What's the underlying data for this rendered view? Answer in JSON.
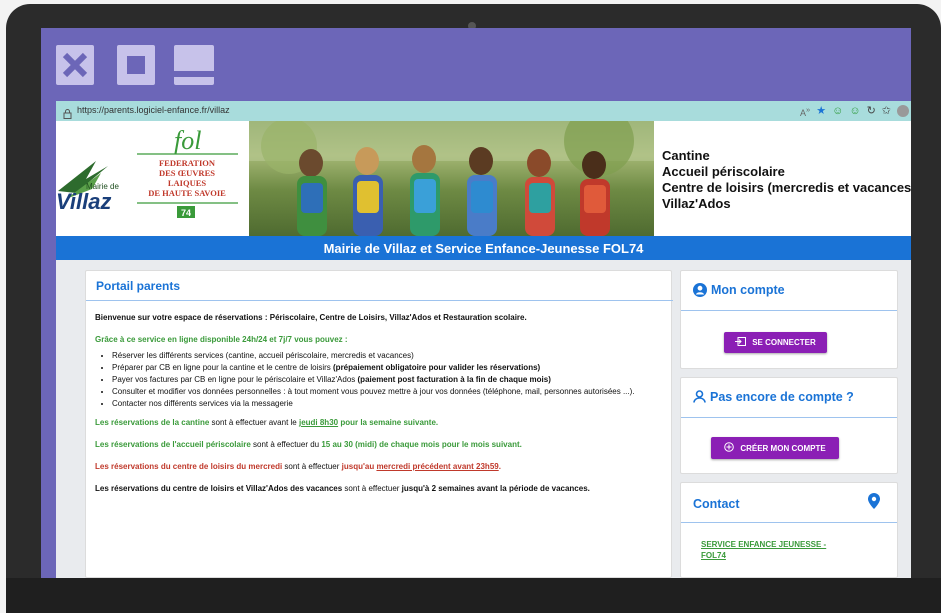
{
  "window_controls": {
    "close": "close-icon",
    "maximize": "maximize-icon",
    "minimize": "minimize-icon"
  },
  "address_bar": {
    "url": "https://parents.logiciel-enfance.fr/villaz"
  },
  "header": {
    "mairie_logo_prefix": "Mairie de",
    "mairie_logo_name": "Villaz",
    "fol_logo_lines": [
      "FEDERATION",
      "DES ŒUVRES",
      "LAIQUES",
      "DE HAUTE SAVOIE"
    ],
    "fol_logo_number": "74",
    "services": [
      "Cantine",
      "Accueil périscolaire",
      "Centre de loisirs (mercredis et vacances)",
      "Villaz'Ados"
    ]
  },
  "title_bar": "Mairie de Villaz et Service Enfance-Jeunesse FOL74",
  "portal": {
    "title": "Portail parents",
    "welcome": "Bienvenue sur votre espace de réservations : Périscolaire, Centre de Loisirs, Villaz'Ados et Restauration scolaire.",
    "intro": "Grâce à ce service en ligne disponible 24h/24 et 7j/7 vous pouvez :",
    "bullets": {
      "b1": "Réserver les différents services (cantine, accueil périscolaire, mercredis et vacances)",
      "b2_a": "Préparer par CB en ligne pour la cantine et le centre de loisirs ",
      "b2_b": "(prépaiement obligatoire pour valider les réservations)",
      "b3_a": "Payer vos factures par CB en ligne pour le périscolaire et Villaz'Ados ",
      "b3_b": "(paiement post facturation à la fin de chaque mois)",
      "b4": "Consulter et modifier vos données personnelles : à tout moment vous pouvez mettre à jour vos données (téléphone, mail, personnes autorisées ...).",
      "b5": "Contacter nos différents services via la messagerie"
    },
    "cantine": {
      "a": "Les réservations de la cantine",
      "b": " sont à effectuer avant le ",
      "c": "jeudi 8h30",
      "d": " pour la semaine suivante."
    },
    "periscolaire": {
      "a": "Les réservations de l'accueil périscolaire",
      "b": " sont à effectuer du ",
      "c": "15 au 30 (midi) de chaque mois pour le mois suivant."
    },
    "mercredi": {
      "a": "Les réservations du centre de loisirs du mercredi",
      "b": " sont à effectuer ",
      "c": "jusqu'au ",
      "d": "mercredi précédent avant 23h59",
      "e": "."
    },
    "vacances": {
      "a": "Les réservations du centre de loisirs et Villaz'Ados des vacances",
      "b": " sont à effectuer ",
      "c": "jusqu'à 2 semaines avant la période de vacances."
    }
  },
  "account": {
    "title": "Mon compte",
    "login_button": "SE CONNECTER"
  },
  "signup": {
    "title": "Pas encore de compte ?",
    "create_button": "CRÉER MON COMPTE"
  },
  "contact": {
    "title": "Contact",
    "link": "SERVICE ENFANCE JEUNESSE - FOL74"
  },
  "colors": {
    "accent_blue": "#1a73d6",
    "button_purple": "#8b1fb5",
    "green_text": "#3a9a3a",
    "red_text": "#c0392b",
    "frame_purple": "#6c66b8",
    "address_bar": "#a8dcdc"
  }
}
